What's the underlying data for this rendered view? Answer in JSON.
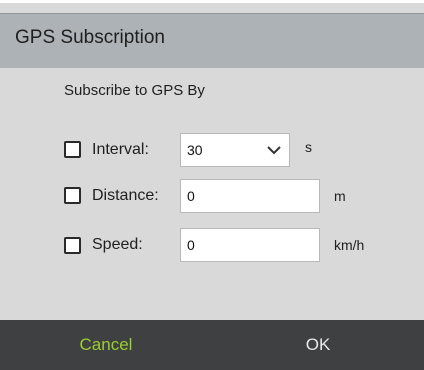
{
  "dialog": {
    "title": "GPS Subscription",
    "subtitle": "Subscribe to GPS By"
  },
  "options": {
    "interval": {
      "label": "Interval:",
      "checked": false,
      "value": "30",
      "unit": "s"
    },
    "distance": {
      "label": "Distance:",
      "checked": false,
      "value": "0",
      "unit": "m"
    },
    "speed": {
      "label": "Speed:",
      "checked": false,
      "value": "0",
      "unit": "km/h"
    }
  },
  "footer": {
    "cancel_label": "Cancel",
    "ok_label": "OK"
  },
  "colors": {
    "title_bar": "#adb2b6",
    "body_background": "#d9d9d9",
    "footer_background": "#3f4041",
    "cancel_text": "#9acd32",
    "ok_text": "#e8e8e8"
  },
  "icons": {
    "dropdown": "chevron-down-icon"
  }
}
